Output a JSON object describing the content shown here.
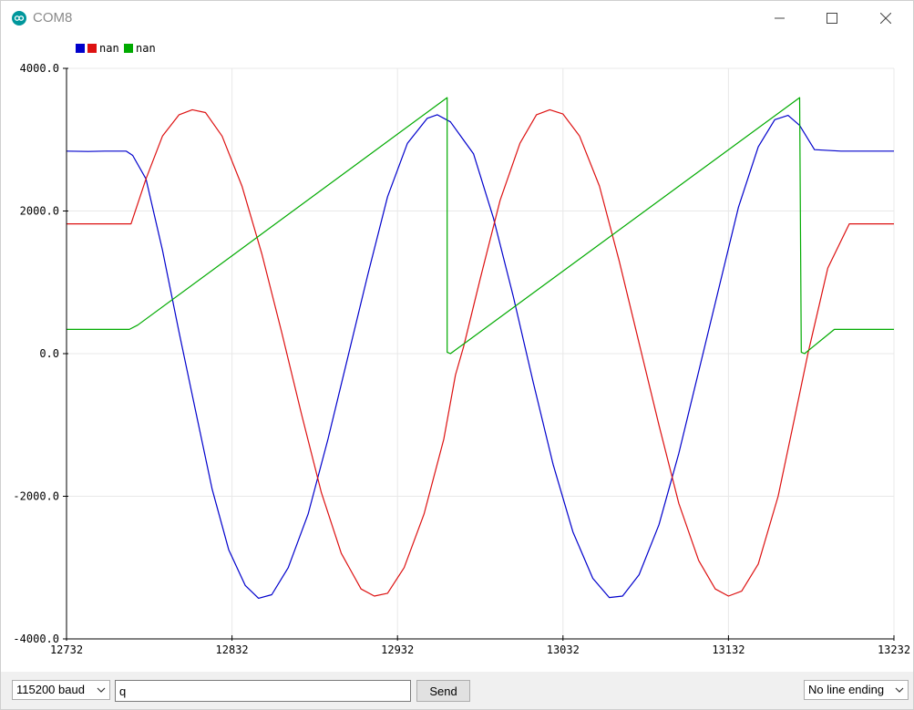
{
  "window": {
    "title": "COM8"
  },
  "colors": {
    "series1": "#0000cc",
    "series2": "#dd1111",
    "series3": "#00aa00",
    "grid": "#e8e8e8",
    "axis": "#000000"
  },
  "chart_data": {
    "type": "line",
    "title": "",
    "xlabel": "",
    "ylabel": "",
    "xlim": [
      12732,
      13232
    ],
    "ylim": [
      -4000,
      4000
    ],
    "x_ticks": [
      12732,
      12832,
      12932,
      13032,
      13132,
      13232
    ],
    "x_tick_labels": [
      "12732",
      "12832",
      "12932",
      "13032",
      "13132",
      "13232"
    ],
    "y_ticks": [
      -4000,
      -2000,
      0,
      2000,
      4000
    ],
    "y_tick_labels": [
      "-4000.0",
      "-2000.0",
      "0.0",
      "2000.0",
      "4000.0"
    ],
    "grid": true,
    "legend": {
      "position": "top-left",
      "labels": [
        "nan",
        "nan"
      ]
    },
    "series": [
      {
        "color_key": "series1",
        "points": [
          [
            12732,
            2840
          ],
          [
            12745,
            2835
          ],
          [
            12755,
            2840
          ],
          [
            12768,
            2840
          ],
          [
            12772,
            2780
          ],
          [
            12780,
            2450
          ],
          [
            12790,
            1450
          ],
          [
            12800,
            300
          ],
          [
            12810,
            -800
          ],
          [
            12820,
            -1900
          ],
          [
            12830,
            -2750
          ],
          [
            12840,
            -3250
          ],
          [
            12848,
            -3430
          ],
          [
            12856,
            -3380
          ],
          [
            12866,
            -3000
          ],
          [
            12878,
            -2250
          ],
          [
            12890,
            -1200
          ],
          [
            12902,
            -50
          ],
          [
            12914,
            1100
          ],
          [
            12926,
            2200
          ],
          [
            12938,
            2950
          ],
          [
            12950,
            3300
          ],
          [
            12956,
            3350
          ],
          [
            12964,
            3250
          ],
          [
            12978,
            2800
          ],
          [
            12990,
            1900
          ],
          [
            13002,
            800
          ],
          [
            13014,
            -400
          ],
          [
            13026,
            -1550
          ],
          [
            13038,
            -2500
          ],
          [
            13050,
            -3150
          ],
          [
            13060,
            -3420
          ],
          [
            13068,
            -3400
          ],
          [
            13078,
            -3100
          ],
          [
            13090,
            -2400
          ],
          [
            13102,
            -1400
          ],
          [
            13114,
            -250
          ],
          [
            13126,
            900
          ],
          [
            13138,
            2050
          ],
          [
            13150,
            2900
          ],
          [
            13160,
            3280
          ],
          [
            13168,
            3340
          ],
          [
            13175,
            3200
          ],
          [
            13184,
            2860
          ],
          [
            13200,
            2840
          ],
          [
            13232,
            2840
          ]
        ]
      },
      {
        "color_key": "series2",
        "points": [
          [
            12732,
            1820
          ],
          [
            12771,
            1820
          ],
          [
            12780,
            2450
          ],
          [
            12790,
            3050
          ],
          [
            12800,
            3350
          ],
          [
            12808,
            3420
          ],
          [
            12816,
            3380
          ],
          [
            12826,
            3050
          ],
          [
            12838,
            2350
          ],
          [
            12850,
            1400
          ],
          [
            12862,
            300
          ],
          [
            12874,
            -850
          ],
          [
            12886,
            -1950
          ],
          [
            12898,
            -2800
          ],
          [
            12910,
            -3300
          ],
          [
            12918,
            -3400
          ],
          [
            12926,
            -3360
          ],
          [
            12936,
            -3000
          ],
          [
            12948,
            -2250
          ],
          [
            12960,
            -1200
          ],
          [
            12967,
            -300
          ],
          [
            12972,
            100
          ],
          [
            12982,
            1050
          ],
          [
            12994,
            2150
          ],
          [
            13006,
            2950
          ],
          [
            13016,
            3350
          ],
          [
            13024,
            3420
          ],
          [
            13032,
            3360
          ],
          [
            13042,
            3050
          ],
          [
            13054,
            2350
          ],
          [
            13066,
            1300
          ],
          [
            13078,
            150
          ],
          [
            13090,
            -1000
          ],
          [
            13102,
            -2100
          ],
          [
            13114,
            -2900
          ],
          [
            13124,
            -3300
          ],
          [
            13132,
            -3400
          ],
          [
            13140,
            -3330
          ],
          [
            13150,
            -2950
          ],
          [
            13162,
            -2000
          ],
          [
            13172,
            -900
          ],
          [
            13180,
            0
          ],
          [
            13192,
            1200
          ],
          [
            13205,
            1820
          ],
          [
            13232,
            1820
          ]
        ]
      },
      {
        "color_key": "series3",
        "points": [
          [
            12732,
            340
          ],
          [
            12770,
            340
          ],
          [
            12775,
            400
          ],
          [
            12962,
            3590
          ],
          [
            12962,
            20
          ],
          [
            12964,
            0
          ],
          [
            13175,
            3590
          ],
          [
            13176,
            20
          ],
          [
            13178,
            0
          ],
          [
            13196,
            340
          ],
          [
            13232,
            340
          ]
        ]
      }
    ]
  },
  "toolbar": {
    "baud_value": "115200 baud",
    "input_value": "q",
    "send_label": "Send",
    "line_ending_value": "No line ending"
  }
}
